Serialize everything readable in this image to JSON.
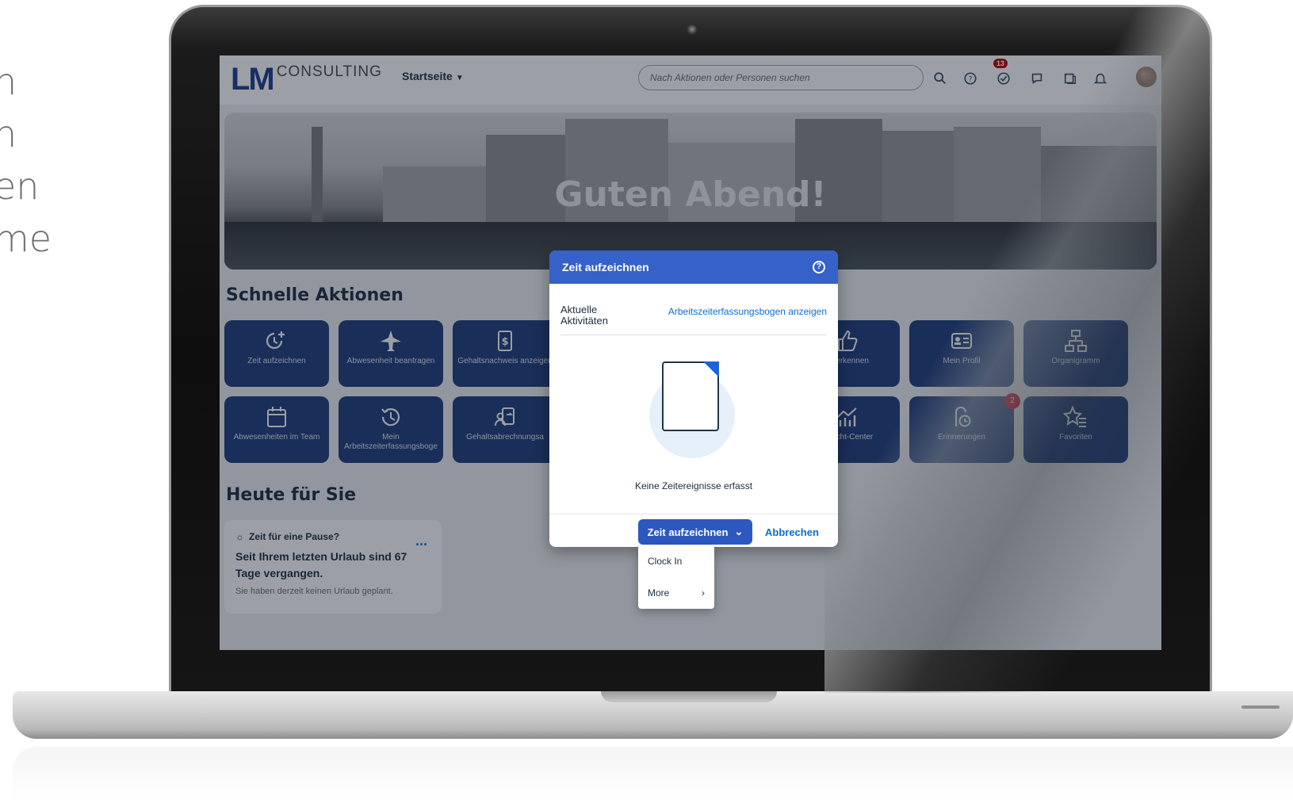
{
  "side_text": [
    "n",
    "n",
    "en",
    "me"
  ],
  "shellbar": {
    "logo_main": "LM",
    "logo_sub": "CONSULTING",
    "home_menu": "Startseite",
    "search_placeholder": "Nach Aktionen oder Personen suchen",
    "notification_count": "13",
    "icons": [
      "search-icon",
      "help-icon",
      "tasks-icon",
      "chat-icon",
      "notes-icon",
      "bell-icon",
      "avatar"
    ]
  },
  "banner": {
    "greeting": "Guten Abend!"
  },
  "quick_actions": {
    "title": "Schnelle Aktionen",
    "tiles": [
      {
        "label": "Zeit aufzeichnen",
        "icon": "clock-plus-icon"
      },
      {
        "label": "Abwesenheit beantragen",
        "icon": "airplane-icon"
      },
      {
        "label": "Gehaltsnachweis anzeigen",
        "icon": "payslip-icon"
      },
      {
        "label": "Anerkennen",
        "icon": "thumbs-up-icon"
      },
      {
        "label": "Mein Profil",
        "icon": "id-card-icon"
      },
      {
        "label": "Organigramm",
        "icon": "org-chart-icon"
      },
      {
        "label": "Abwesenheiten im Team",
        "icon": "calendar-icon"
      },
      {
        "label": "Mein Arbeitszeiterfassungsboge",
        "icon": "history-icon"
      },
      {
        "label": "Gehaltsabrechnungsa",
        "icon": "person-transfer-icon"
      },
      {
        "label": "Bericht-Center",
        "icon": "chart-icon"
      },
      {
        "label": "Erinnerungen",
        "icon": "reminder-icon",
        "badge": "2"
      },
      {
        "label": "Favoriten",
        "icon": "star-list-icon"
      }
    ]
  },
  "today": {
    "title": "Heute für Sie",
    "card_head": "Zeit für eine Pause?",
    "card_main": "Seit Ihrem letzten Urlaub sind 67 Tage vergangen.",
    "card_sub": "Sie haben derzeit keinen Urlaub geplant.",
    "card_more": "..."
  },
  "dialog": {
    "title": "Zeit aufzeichnen",
    "activities_label": "Aktuelle Aktivitäten",
    "timesheet_link": "Arbeitszeiterfassungsbogen anzeigen",
    "empty_text": "Keine Zeitereignisse erfasst",
    "primary_button": "Zeit aufzeichnen",
    "cancel_button": "Abbrechen"
  },
  "dropdown": {
    "items": [
      {
        "label": "Clock In"
      },
      {
        "label": "More",
        "has_submenu": true
      }
    ]
  },
  "colors": {
    "tile_blue": "#1e3b7a",
    "dialog_header": "#3561c9",
    "link": "#0a6ed1",
    "badge_red": "#bb0000"
  }
}
